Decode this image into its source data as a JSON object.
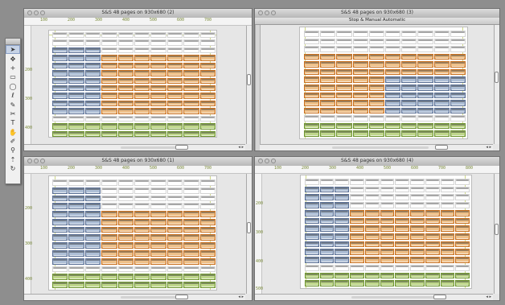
{
  "windows": [
    {
      "id": "tl",
      "title": "S&S 48 pages on 930x680 (2)",
      "ruler_ticks": [
        "100",
        "200",
        "300",
        "400",
        "500",
        "600",
        "700"
      ],
      "side_ticks": [
        "200",
        "300",
        "400"
      ]
    },
    {
      "id": "tr",
      "title": "S&S 48 pages on 930x680 (3)",
      "panel_title": "Stop & Manual Automatic",
      "ruler_ticks": [],
      "side_ticks": []
    },
    {
      "id": "bl",
      "title": "S&S 48 pages on 930x680 (1)",
      "ruler_ticks": [
        "100",
        "200",
        "300",
        "400",
        "500",
        "600",
        "700"
      ],
      "side_ticks": [
        "200",
        "300",
        "400"
      ]
    },
    {
      "id": "br",
      "title": "S&S 48 pages on 930x680 (4)",
      "ruler_ticks": [
        "100",
        "200",
        "300",
        "400",
        "500",
        "600",
        "700",
        "800"
      ],
      "side_ticks": [
        "200",
        "300",
        "400",
        "500"
      ]
    }
  ],
  "toolbox": {
    "tools": [
      "selection-tool",
      "subselection-tool",
      "crosshair-tool",
      "rectangle-tool",
      "ellipse-tool",
      "lasso-tool",
      "pen-tool",
      "scissors-tool",
      "text-tool",
      "hand-tool",
      "eyedropper-tool",
      "zoom-tool",
      "pointer-tool",
      "rotate-tool"
    ],
    "glyphs": [
      "➤",
      "✥",
      "+",
      "▭",
      "◯",
      "ℓ",
      "✎",
      "✂",
      "T",
      "✋",
      "✐",
      "⚲",
      "⇡",
      "↻"
    ]
  },
  "scroll_arrows": "◂ ▸",
  "colors": {
    "blue": "#5a6f94",
    "orange": "#c9701f",
    "green": "#6f9532",
    "guide": "#cfd988"
  }
}
